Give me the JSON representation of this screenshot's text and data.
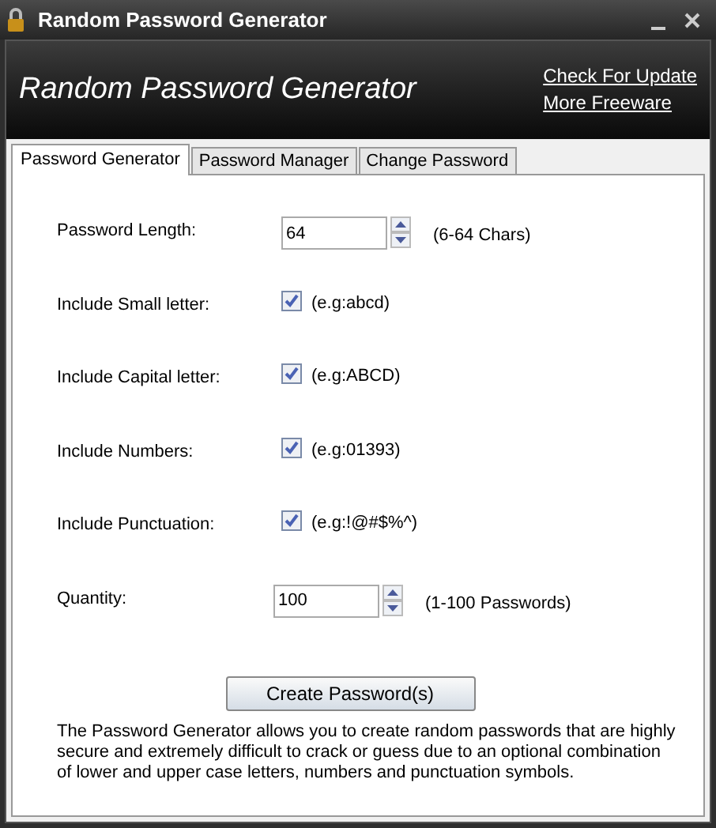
{
  "window": {
    "title": "Random Password Generator"
  },
  "header": {
    "title": "Random Password Generator",
    "links": [
      "Check For Update",
      "More Freeware"
    ]
  },
  "tabs": [
    {
      "label": "Password Generator",
      "selected": true
    },
    {
      "label": "Password Manager",
      "selected": false
    },
    {
      "label": "Change Password",
      "selected": false
    }
  ],
  "options": [
    {
      "kind": "spinner",
      "label": "Password Length:",
      "value": "64",
      "hint": "(6-64 Chars)"
    },
    {
      "kind": "checkbox",
      "label": "Include Small letter:",
      "checked": true,
      "hint": "(e.g:abcd)"
    },
    {
      "kind": "checkbox",
      "label": "Include Capital letter:",
      "checked": true,
      "hint": "(e.g:ABCD)"
    },
    {
      "kind": "checkbox",
      "label": "Include Numbers:",
      "checked": true,
      "hint": "(e.g:01393)"
    },
    {
      "kind": "checkbox",
      "label": "Include Punctuation:",
      "checked": true,
      "hint": "(e.g:!@#$%^)"
    },
    {
      "kind": "spinner",
      "label": "Quantity:",
      "value": "100",
      "hint": "(1-100 Passwords)"
    }
  ],
  "create_button": "Create Password(s)",
  "description": "The Password Generator allows you to create random passwords that are highly secure and extremely difficult to crack or guess due to an optional combination of lower and upper case letters, numbers and punctuation symbols."
}
